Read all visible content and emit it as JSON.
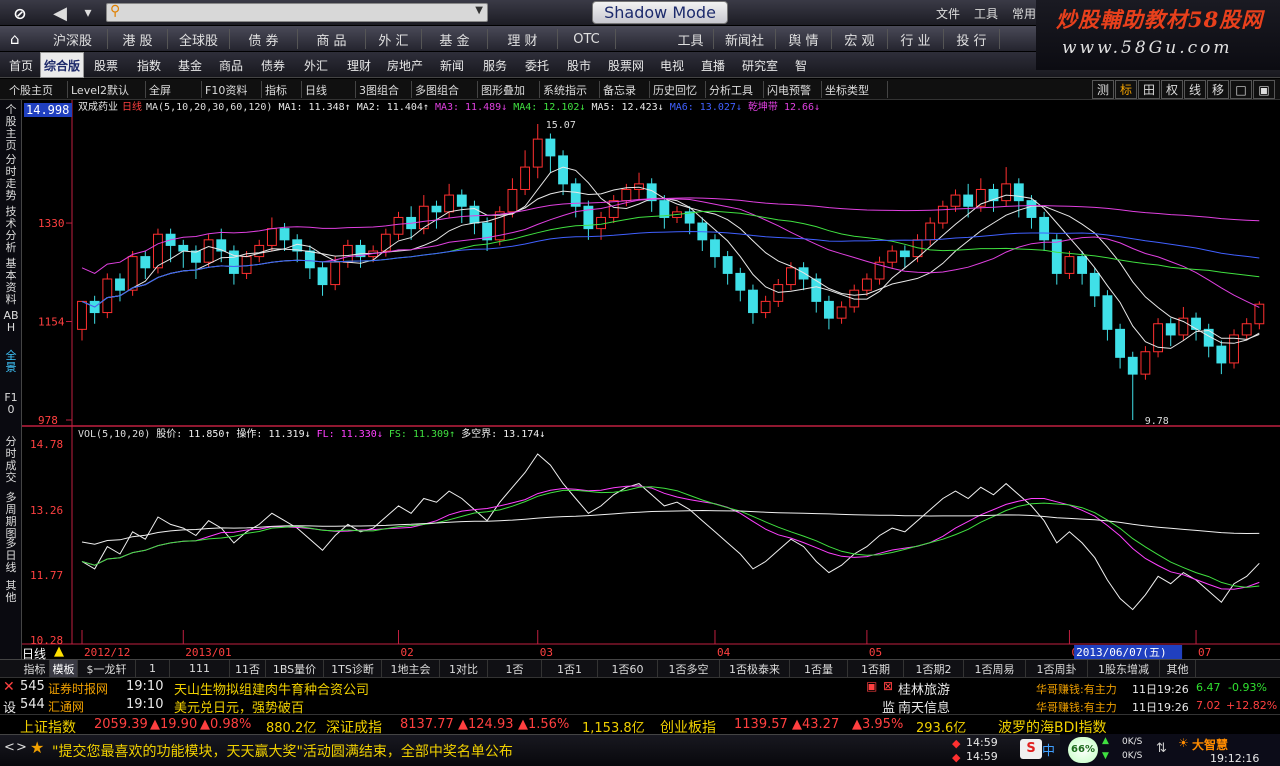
{
  "topbar": {
    "search_placeholder": "",
    "shadow_label": "Shadow Mode",
    "menus": [
      "文件",
      "工具",
      "常用"
    ]
  },
  "brand": {
    "title_a": "炒股輔助教材",
    "title_b": "58股网",
    "url": "www.58Gu.com"
  },
  "markets": [
    "沪深股",
    "港 股",
    "全球股",
    "债 券",
    "商 品",
    "外 汇",
    "基 金",
    "理 财",
    "OTC"
  ],
  "markets2": [
    "工具",
    "新闻社",
    "舆 情",
    "宏 观",
    "行 业",
    "投 行"
  ],
  "nav": [
    "首页",
    "综合版",
    "股票",
    "指数",
    "基金",
    "商品",
    "债券",
    "外汇",
    "理财",
    "房地产",
    "新闻",
    "服务",
    "委托",
    "股市",
    "股票网",
    "电视",
    "直播",
    "研究室",
    "智"
  ],
  "nav_active": 1,
  "toolbar": [
    "个股主页",
    "Level2默认",
    "全屏",
    "F10资料",
    "指标",
    "日线",
    "3图组合",
    "多图组合",
    "图形叠加",
    "系统指示",
    "备忘录",
    "历史回忆",
    "分析工具",
    "闪电预警",
    "坐标类型"
  ],
  "right_tools": [
    "测",
    "标",
    "田",
    "权",
    "线",
    "移",
    "□",
    "▣"
  ],
  "right_tools_active": 1,
  "leftbar": [
    "个股主页",
    "分时走势",
    "技术分析",
    "基本资料",
    "ABH",
    "全景",
    "F10",
    "分时成交",
    "多周期图",
    "多日线",
    "其他"
  ],
  "chart": {
    "stock_name": "双成药业",
    "period": "日线",
    "ma_header": "MA(5,10,20,30,60,120)",
    "ma_values": [
      {
        "label": "MA1: 11.348↑",
        "color": "#e8e8e8"
      },
      {
        "label": "MA2: 11.404↑",
        "color": "#e8e8e8"
      },
      {
        "label": "MA3: 11.489↓",
        "color": "#e040e0"
      },
      {
        "label": "MA4: 12.102↓",
        "color": "#40e040"
      },
      {
        "label": "MA5: 12.423↓",
        "color": "#e8e8e8"
      },
      {
        "label": "MA6: 13.027↓",
        "color": "#4060ff"
      },
      {
        "label": "乾坤带",
        "color": "#e040e0"
      },
      {
        "label": "12.66↓",
        "color": "#e040e0"
      }
    ],
    "price_axis": [
      "14.998",
      "1330",
      "1154",
      "978"
    ],
    "hi_label": "15.07",
    "lo_label": "9.78",
    "osc_header": "VOL(5,10,20)",
    "osc_values": [
      {
        "label": "股价: 11.850↑",
        "color": "#f0f0f0"
      },
      {
        "label": "操作: 11.319↓",
        "color": "#f0f0f0"
      },
      {
        "label": "FL: 11.330↓",
        "color": "#ff40ff"
      },
      {
        "label": "FS: 11.309↑",
        "color": "#40e040"
      },
      {
        "label": "多空界: 13.174↓",
        "color": "#f0f0f0"
      }
    ],
    "osc_axis": [
      "14.78",
      "13.26",
      "11.77",
      "10.28"
    ],
    "date_labels": [
      "2012/12",
      "2013/01",
      "02",
      "03",
      "04",
      "05",
      "06",
      "07"
    ],
    "date_highlight": "2013/06/07(五)",
    "period_tab": "日线"
  },
  "chart_data": {
    "type": "candlestick",
    "y_range": [
      9.78,
      15.07
    ],
    "osc_range": [
      10.28,
      14.78
    ],
    "candles": [
      [
        11.4,
        11.9,
        11.2,
        11.9
      ],
      [
        11.9,
        11.7,
        11.5,
        12.0
      ],
      [
        11.7,
        12.3,
        11.6,
        12.4
      ],
      [
        12.3,
        12.1,
        11.9,
        12.4
      ],
      [
        12.1,
        12.7,
        12.0,
        12.8
      ],
      [
        12.7,
        12.5,
        12.3,
        12.8
      ],
      [
        12.5,
        13.1,
        12.4,
        13.2
      ],
      [
        13.1,
        12.9,
        12.6,
        13.2
      ],
      [
        12.9,
        12.8,
        12.5,
        13.0
      ],
      [
        12.8,
        12.6,
        12.3,
        12.9
      ],
      [
        12.6,
        13.0,
        12.5,
        13.1
      ],
      [
        13.0,
        12.8,
        12.6,
        13.2
      ],
      [
        12.8,
        12.4,
        12.2,
        12.9
      ],
      [
        12.4,
        12.7,
        12.3,
        12.8
      ],
      [
        12.7,
        12.9,
        12.6,
        13.0
      ],
      [
        12.9,
        13.2,
        12.8,
        13.4
      ],
      [
        13.2,
        13.0,
        12.8,
        13.3
      ],
      [
        13.0,
        12.8,
        12.6,
        13.1
      ],
      [
        12.8,
        12.5,
        12.3,
        12.9
      ],
      [
        12.5,
        12.2,
        12.0,
        12.6
      ],
      [
        12.2,
        12.6,
        12.1,
        12.7
      ],
      [
        12.6,
        12.9,
        12.5,
        13.0
      ],
      [
        12.9,
        12.7,
        12.5,
        13.0
      ],
      [
        12.7,
        12.8,
        12.6,
        12.9
      ],
      [
        12.8,
        13.1,
        12.7,
        13.2
      ],
      [
        13.1,
        13.4,
        13.0,
        13.5
      ],
      [
        13.4,
        13.2,
        13.0,
        13.6
      ],
      [
        13.2,
        13.6,
        13.1,
        13.8
      ],
      [
        13.6,
        13.5,
        13.2,
        13.7
      ],
      [
        13.5,
        13.8,
        13.4,
        14.0
      ],
      [
        13.8,
        13.6,
        13.3,
        13.9
      ],
      [
        13.6,
        13.3,
        13.1,
        13.7
      ],
      [
        13.3,
        13.0,
        12.8,
        13.4
      ],
      [
        13.0,
        13.5,
        12.9,
        13.6
      ],
      [
        13.5,
        13.9,
        13.4,
        14.1
      ],
      [
        13.9,
        14.3,
        13.8,
        14.6
      ],
      [
        14.3,
        14.8,
        14.1,
        15.07
      ],
      [
        14.8,
        14.5,
        14.2,
        14.9
      ],
      [
        14.5,
        14.0,
        13.8,
        14.6
      ],
      [
        14.0,
        13.6,
        13.4,
        14.1
      ],
      [
        13.6,
        13.2,
        13.0,
        13.7
      ],
      [
        13.2,
        13.4,
        13.0,
        13.5
      ],
      [
        13.4,
        13.7,
        13.3,
        13.8
      ],
      [
        13.7,
        13.9,
        13.6,
        14.0
      ],
      [
        13.9,
        14.0,
        13.7,
        14.2
      ],
      [
        14.0,
        13.7,
        13.5,
        14.1
      ],
      [
        13.7,
        13.4,
        13.2,
        13.8
      ],
      [
        13.4,
        13.5,
        13.3,
        13.6
      ],
      [
        13.5,
        13.3,
        13.1,
        13.6
      ],
      [
        13.3,
        13.0,
        12.8,
        13.4
      ],
      [
        13.0,
        12.7,
        12.5,
        13.1
      ],
      [
        12.7,
        12.4,
        12.2,
        12.8
      ],
      [
        12.4,
        12.1,
        11.9,
        12.5
      ],
      [
        12.1,
        11.7,
        11.5,
        12.2
      ],
      [
        11.7,
        11.9,
        11.6,
        12.0
      ],
      [
        11.9,
        12.2,
        11.8,
        12.3
      ],
      [
        12.2,
        12.5,
        12.1,
        12.6
      ],
      [
        12.5,
        12.3,
        12.1,
        12.6
      ],
      [
        12.3,
        11.9,
        11.7,
        12.4
      ],
      [
        11.9,
        11.6,
        11.4,
        12.0
      ],
      [
        11.6,
        11.8,
        11.5,
        11.9
      ],
      [
        11.8,
        12.1,
        11.7,
        12.2
      ],
      [
        12.1,
        12.3,
        12.0,
        12.4
      ],
      [
        12.3,
        12.6,
        12.2,
        12.7
      ],
      [
        12.6,
        12.8,
        12.5,
        12.9
      ],
      [
        12.8,
        12.7,
        12.5,
        12.9
      ],
      [
        12.7,
        13.0,
        12.6,
        13.1
      ],
      [
        13.0,
        13.3,
        12.9,
        13.4
      ],
      [
        13.3,
        13.6,
        13.2,
        13.7
      ],
      [
        13.6,
        13.8,
        13.5,
        13.9
      ],
      [
        13.8,
        13.6,
        13.4,
        14.0
      ],
      [
        13.6,
        13.9,
        13.5,
        14.1
      ],
      [
        13.9,
        13.7,
        13.5,
        14.0
      ],
      [
        13.7,
        14.0,
        13.6,
        14.3
      ],
      [
        14.0,
        13.7,
        13.4,
        14.1
      ],
      [
        13.7,
        13.4,
        13.2,
        13.8
      ],
      [
        13.4,
        13.0,
        12.8,
        13.5
      ],
      [
        13.0,
        12.4,
        12.2,
        13.1
      ],
      [
        12.4,
        12.7,
        12.3,
        12.8
      ],
      [
        12.7,
        12.4,
        12.2,
        12.8
      ],
      [
        12.4,
        12.0,
        11.8,
        12.5
      ],
      [
        12.0,
        11.4,
        11.2,
        12.1
      ],
      [
        11.4,
        10.9,
        10.7,
        11.5
      ],
      [
        10.9,
        10.6,
        9.78,
        11.0
      ],
      [
        10.6,
        11.0,
        10.5,
        11.1
      ],
      [
        11.0,
        11.5,
        10.9,
        11.6
      ],
      [
        11.5,
        11.3,
        11.1,
        11.6
      ],
      [
        11.3,
        11.6,
        11.2,
        11.8
      ],
      [
        11.6,
        11.4,
        11.2,
        11.7
      ],
      [
        11.4,
        11.1,
        10.9,
        11.5
      ],
      [
        11.1,
        10.8,
        10.6,
        11.2
      ],
      [
        10.8,
        11.3,
        10.7,
        11.4
      ],
      [
        11.3,
        11.5,
        11.2,
        11.6
      ],
      [
        11.5,
        11.85,
        11.4,
        11.9
      ]
    ]
  },
  "bottom_tabs": [
    "指标",
    "模板",
    "$一龙轩",
    "1",
    "111",
    "11否",
    "1BS量价",
    "1TS诊断",
    "1地主会",
    "1对比",
    "1否",
    "1否1",
    "1否60",
    "1否多空",
    "1否极泰来",
    "1否量",
    "1否期",
    "1否期2",
    "1否周易",
    "1否周卦",
    "1股东增减",
    "其他"
  ],
  "bottom_active": 1,
  "news": [
    {
      "code": "545",
      "src": "证券时报网",
      "time": "19:10",
      "text": "天山生物拟组建肉牛育种合资公司"
    },
    {
      "code": "544",
      "src": "汇通网",
      "time": "19:10",
      "text": "美元兑日元，强势破百"
    }
  ],
  "watch": [
    {
      "name": "桂林旅游",
      "src": "华哥赚钱:有主力",
      "time": "11日19:26",
      "price": "6.47",
      "pct": "-0.93%"
    },
    {
      "name": "南天信息",
      "src": "华哥赚钱:有主力",
      "time": "11日19:26",
      "price": "7.02",
      "pct": "+12.82%"
    }
  ],
  "watch_prefix": [
    "设",
    "监"
  ],
  "index_bar": [
    {
      "name": "上证指数",
      "val": "2059.39",
      "chg": "▲19.90",
      "pct": "▲0.98%",
      "amt": "880.2亿"
    },
    {
      "name": "深证成指",
      "val": "8137.77",
      "chg": "▲124.93",
      "pct": "▲1.56%",
      "amt": "1,153.8亿"
    },
    {
      "name": "创业板指",
      "val": "1139.57",
      "chg": "▲43.27",
      "pct": "▲3.95%",
      "amt": "293.6亿"
    }
  ],
  "index_tail": "波罗的海BDI指数",
  "notice": "\"提交您最喜欢的功能模块，天天赢大奖\"活动圆满结束，全部中奖名单公布",
  "tray": {
    "time1": "14:59",
    "time2": "14:59",
    "pct": "66%",
    "up": "0K/S",
    "down": "0K/S",
    "brand": "大智慧",
    "clock": "19:12:16"
  }
}
